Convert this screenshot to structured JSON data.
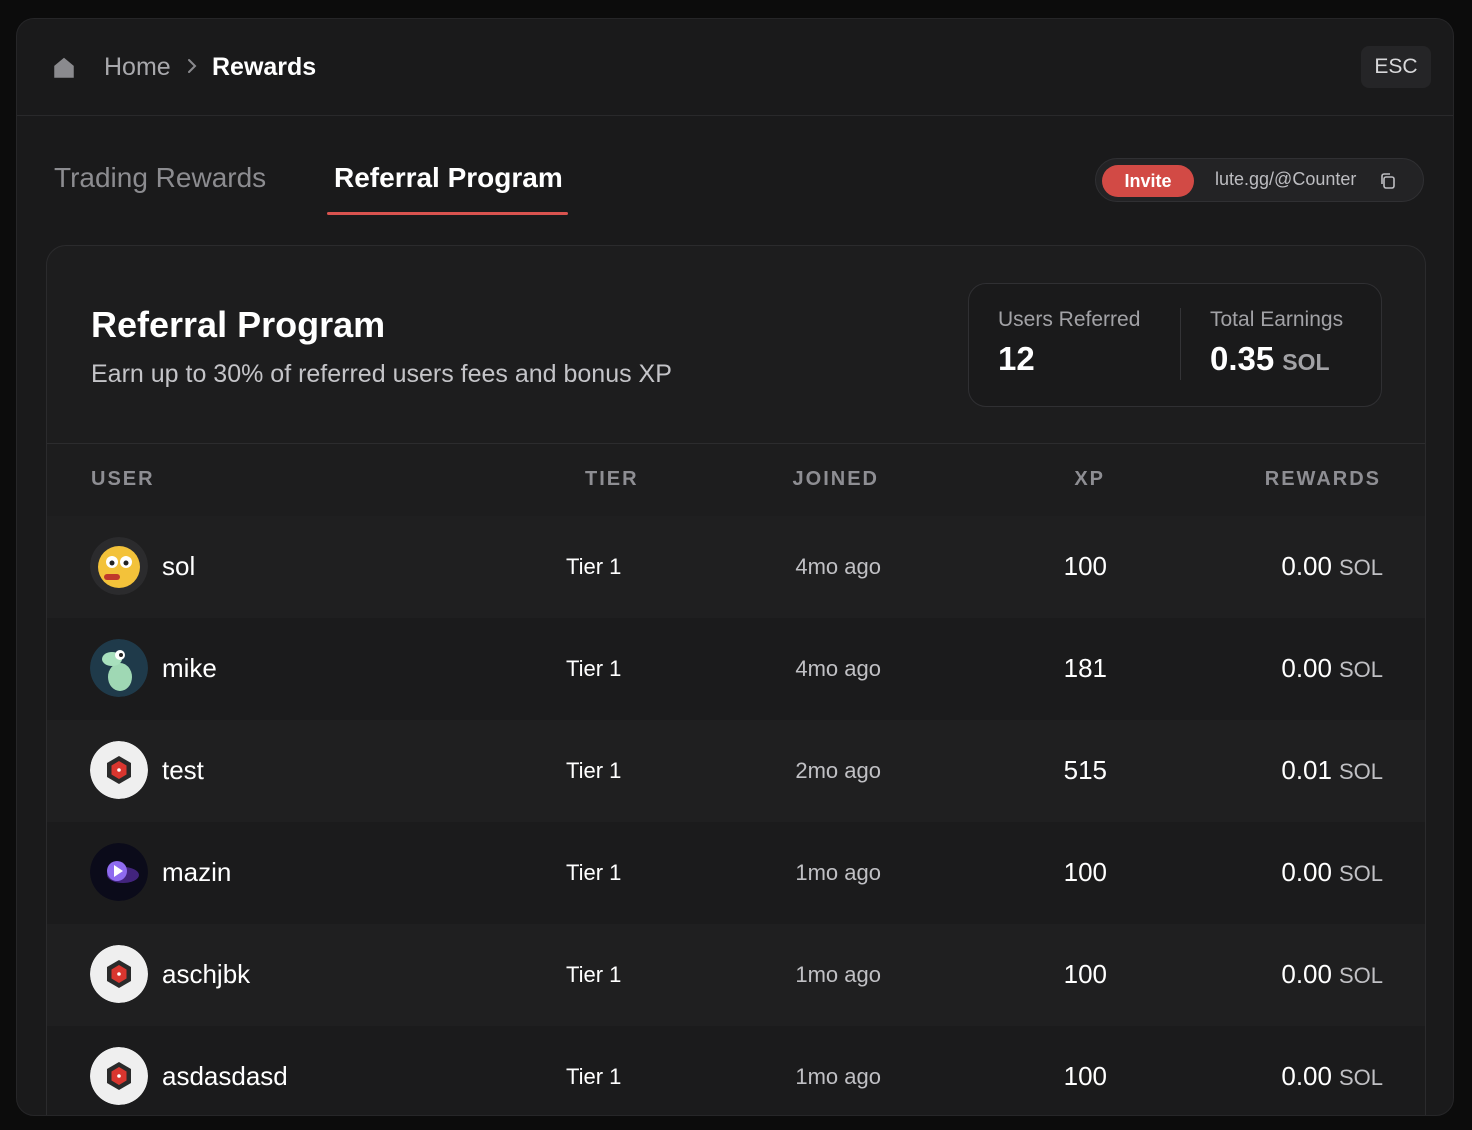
{
  "breadcrumb": {
    "home": "Home",
    "current": "Rewards"
  },
  "esc_label": "ESC",
  "tabs": [
    {
      "label": "Trading Rewards",
      "active": false
    },
    {
      "label": "Referral Program",
      "active": true
    }
  ],
  "invite": {
    "button_label": "Invite",
    "link": "lute.gg/@Counter"
  },
  "card": {
    "title": "Referral Program",
    "subtitle": "Earn up to 30% of referred users fees and bonus XP"
  },
  "stats": {
    "users_referred_label": "Users Referred",
    "users_referred_value": "12",
    "total_earnings_label": "Total Earnings",
    "total_earnings_value": "0.35",
    "total_earnings_unit": "SOL"
  },
  "table": {
    "headers": {
      "user": "USER",
      "tier": "TIER",
      "joined": "JOINED",
      "xp": "XP",
      "rewards": "REWARDS"
    },
    "rows": [
      {
        "user": "sol",
        "avatar": "emoji-face-avatar",
        "tier": "Tier 1",
        "joined": "4mo ago",
        "xp": "100",
        "reward": "0.00",
        "unit": "SOL"
      },
      {
        "user": "mike",
        "avatar": "frog-avatar",
        "tier": "Tier 1",
        "joined": "4mo ago",
        "xp": "181",
        "reward": "0.00",
        "unit": "SOL"
      },
      {
        "user": "test",
        "avatar": "hexagon-logo-avatar",
        "tier": "Tier 1",
        "joined": "2mo ago",
        "xp": "515",
        "reward": "0.01",
        "unit": "SOL"
      },
      {
        "user": "mazin",
        "avatar": "purple-orb-avatar",
        "tier": "Tier 1",
        "joined": "1mo ago",
        "xp": "100",
        "reward": "0.00",
        "unit": "SOL"
      },
      {
        "user": "aschjbk",
        "avatar": "hexagon-logo-avatar",
        "tier": "Tier 1",
        "joined": "1mo ago",
        "xp": "100",
        "reward": "0.00",
        "unit": "SOL"
      },
      {
        "user": "asdasdasd",
        "avatar": "hexagon-logo-avatar",
        "tier": "Tier 1",
        "joined": "1mo ago",
        "xp": "100",
        "reward": "0.00",
        "unit": "SOL"
      }
    ]
  },
  "colors": {
    "accent": "#d24a45",
    "background": "#1a1a1b"
  }
}
